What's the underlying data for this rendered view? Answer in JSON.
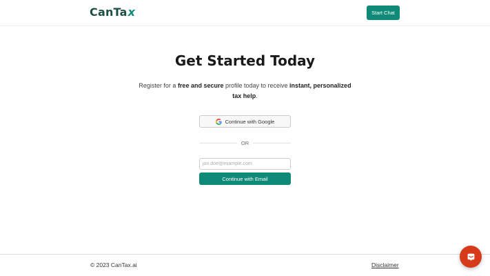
{
  "header": {
    "logo_main": "CanTa",
    "logo_accent": "x",
    "start_chat_label": "Start Chat"
  },
  "main": {
    "title": "Get Started Today",
    "subtitle_part1": "Register for a ",
    "subtitle_bold1": "free and secure",
    "subtitle_part2": " profile today to receive ",
    "subtitle_bold2": "instant, personalized tax help",
    "subtitle_part3": ".",
    "google_button_label": "Continue with Google",
    "or_text": "OR",
    "email_placeholder": "jon.doe@example.com",
    "email_button_label": "Continue with Email"
  },
  "footer": {
    "copyright": "© 2023 CanTax.ai",
    "disclaimer": "Disclaimer"
  },
  "icons": {
    "google": "google-icon",
    "chat": "chat-icon"
  },
  "colors": {
    "brand_green": "#0f8a78",
    "logo_dark": "#1d4e43",
    "chat_red": "#d63a1a"
  }
}
